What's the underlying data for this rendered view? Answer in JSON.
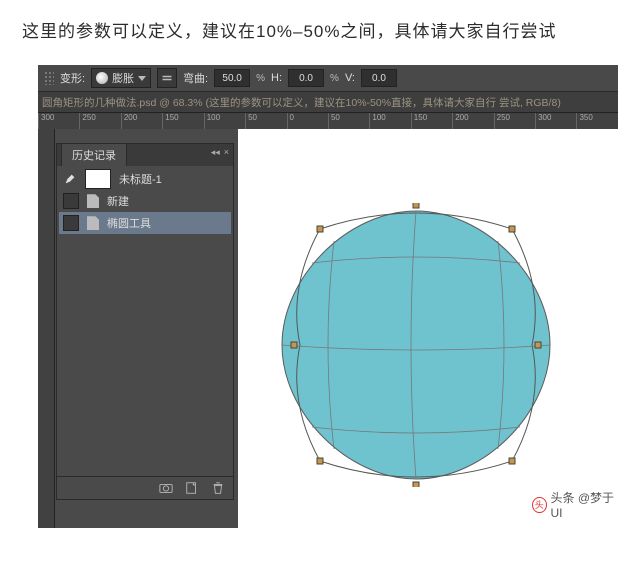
{
  "caption": "这里的参数可以定义，建议在10%–50%之间，具体请大家自行尝试",
  "options": {
    "warp_label": "变形:",
    "warp_mode": "膨胀",
    "bend_label": "弯曲:",
    "bend_value": "50.0",
    "h_label": "H:",
    "h_value": "0.0",
    "v_label": "V:",
    "v_value": "0.0",
    "pct": "%"
  },
  "tab_title": "圆角矩形的几种做法.psd @ 68.3% (这里的参数可以定义，建议在10%-50%直接，具体请大家自行 尝试, RGB/8) ",
  "ruler": [
    "300",
    "250",
    "200",
    "150",
    "100",
    "50",
    "0",
    "50",
    "100",
    "150",
    "200",
    "250",
    "300",
    "350"
  ],
  "history": {
    "panel_title": "历史记录",
    "snapshot": "未标题-1",
    "items": [
      "新建",
      "椭圆工具"
    ]
  },
  "source_handle": "头条 @梦于UI",
  "shape": {
    "fill": "#6fc3cf",
    "stroke": "#5a5a5a"
  }
}
